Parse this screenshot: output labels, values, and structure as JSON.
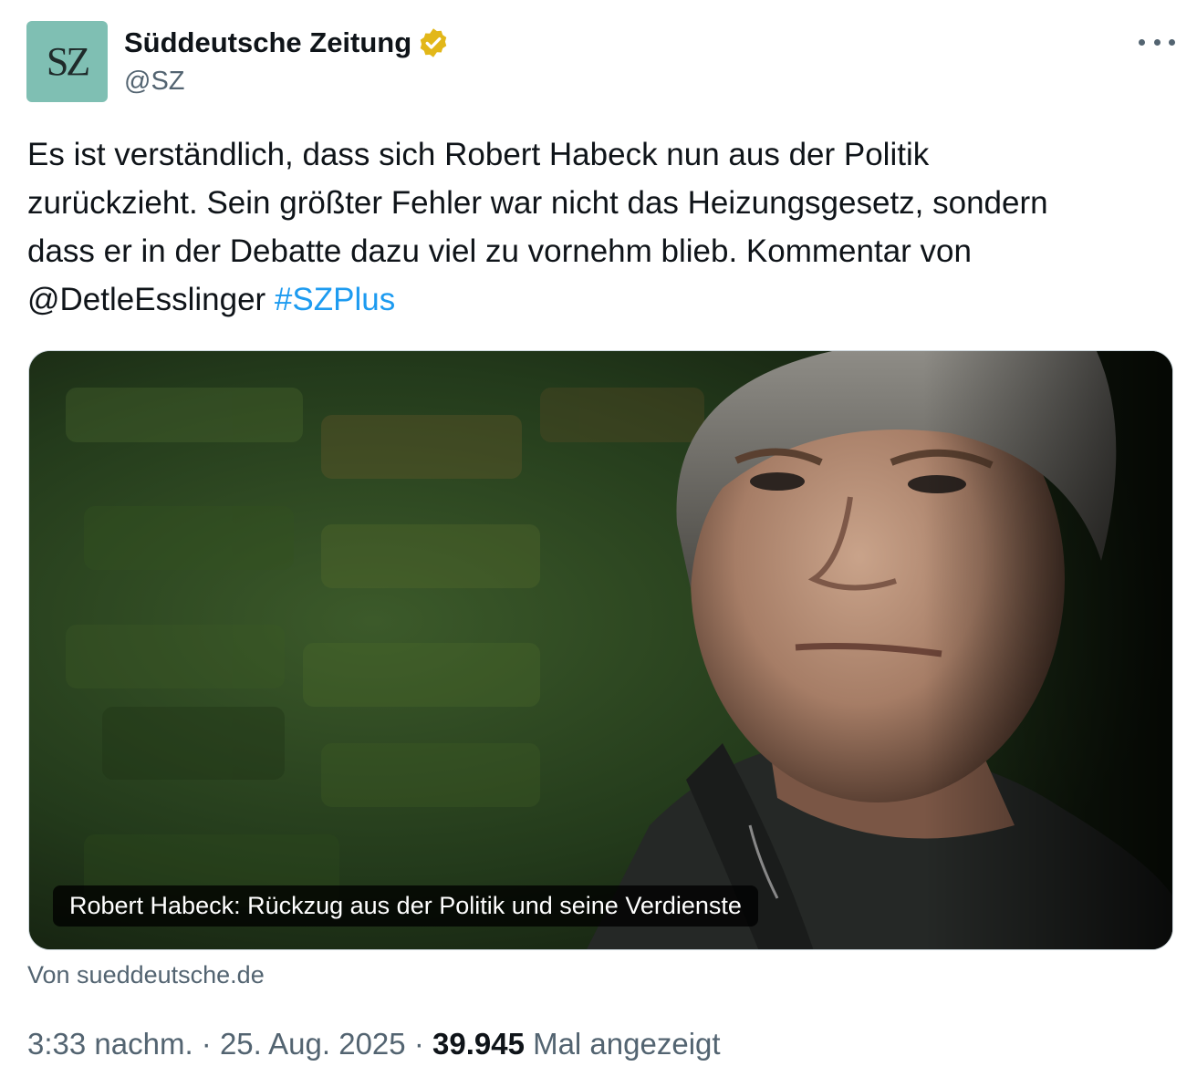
{
  "author": {
    "avatar_text": "SZ",
    "display_name": "Süddeutsche Zeitung",
    "handle": "@SZ",
    "verified_icon": "verified-gold-badge-icon"
  },
  "tweet": {
    "line1": "Es ist verständlich, dass sich Robert Habeck nun aus der Politik",
    "line2": "zurückzieht. Sein größter Fehler war nicht das Heizungsgesetz, sondern",
    "line3": "dass er in der Debatte dazu viel zu vornehm blieb. Kommentar von",
    "mention": "@DetleEsslinger",
    "hashtag": "#SZPlus"
  },
  "card": {
    "caption": "Robert Habeck: Rückzug aus der Politik und seine Verdienste",
    "source": "Von sueddeutsche.de"
  },
  "meta": {
    "time": "3:33 nachm.",
    "sep1": " · ",
    "date": "25. Aug. 2025",
    "sep2": " · ",
    "views_count": "39.945",
    "views_label": " Mal angezeigt"
  },
  "colors": {
    "avatar_bg": "#7fbfb3",
    "verified_gold": "#e2b719",
    "link_blue": "#1d9bf0",
    "secondary_text": "#536471"
  }
}
